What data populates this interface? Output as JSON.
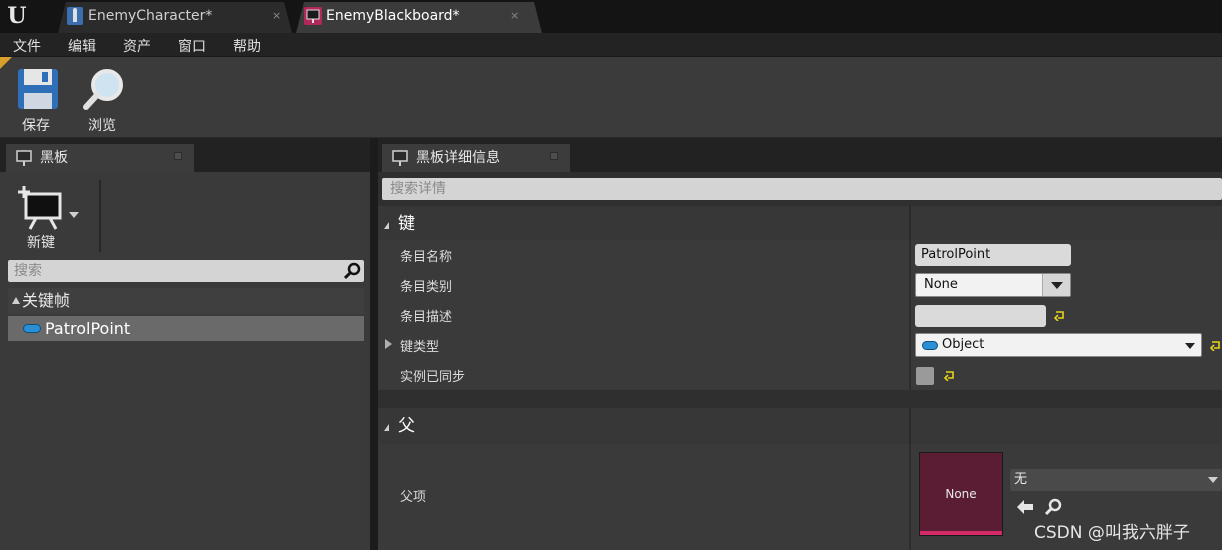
{
  "tabs": [
    {
      "label": "EnemyCharacter*",
      "icon": "character-blueprint-icon",
      "close": "×"
    },
    {
      "label": "EnemyBlackboard*",
      "icon": "blackboard-icon",
      "close": "×"
    }
  ],
  "menu": [
    "文件",
    "编辑",
    "资产",
    "窗口",
    "帮助"
  ],
  "toolbar": {
    "save_label": "保存",
    "browse_label": "浏览"
  },
  "left_panel": {
    "title": "黑板",
    "new_key_label": "新键",
    "search_placeholder": "搜索",
    "category": "关键帧",
    "keys": [
      {
        "name": "PatrolPoint",
        "type_color": "#2a8fd4"
      }
    ]
  },
  "details_panel": {
    "title": "黑板详细信息",
    "search_placeholder": "搜索详情",
    "sections": {
      "key": {
        "title": "键",
        "entry_name_label": "条目名称",
        "entry_name_value": "PatrolPoint",
        "entry_category_label": "条目类别",
        "entry_category_value": "None",
        "entry_description_label": "条目描述",
        "entry_description_value": "",
        "key_type_label": "键类型",
        "key_type_value": "Object",
        "instance_synced_label": "实例已同步",
        "instance_synced_checked": false
      },
      "parent": {
        "title": "父",
        "parent_label": "父项",
        "thumbnail_text": "None",
        "asset_value": "无"
      }
    }
  },
  "watermark": "CSDN @叫我六胖子",
  "colors": {
    "accent_blue": "#2a8fd4",
    "thumb_bg": "#5a1d33",
    "thumb_bar": "#d52a68",
    "reset_yellow": "#e8d31a"
  }
}
